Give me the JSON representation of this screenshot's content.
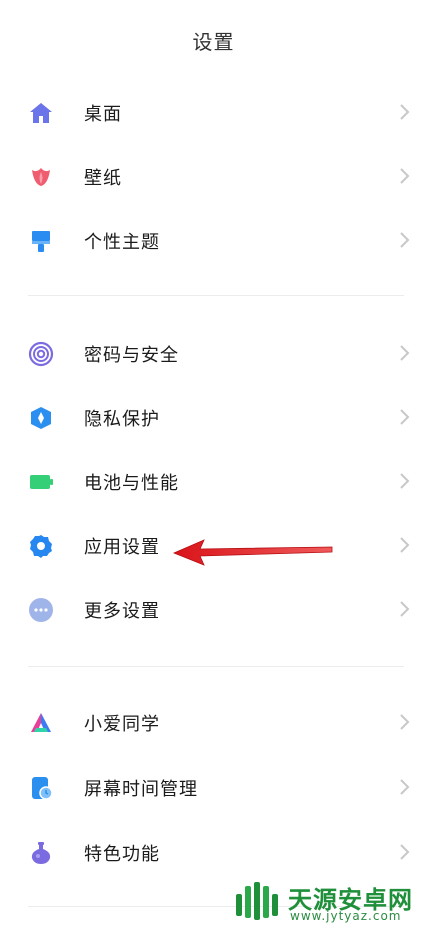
{
  "header": {
    "title": "设置"
  },
  "groups": [
    {
      "items": [
        {
          "label": "桌面",
          "icon": "home-icon",
          "color": "#6b74e8"
        },
        {
          "label": "壁纸",
          "icon": "tulip-icon",
          "color": "#ef5d6f"
        },
        {
          "label": "个性主题",
          "icon": "paintbrush-icon",
          "color": "#2a8cf0"
        }
      ]
    },
    {
      "items": [
        {
          "label": "密码与安全",
          "icon": "fingerprint-icon",
          "color": "#7b6be0"
        },
        {
          "label": "隐私保护",
          "icon": "privacy-shield-icon",
          "color": "#2b8ff0"
        },
        {
          "label": "电池与性能",
          "icon": "battery-icon",
          "color": "#34cf77"
        },
        {
          "label": "应用设置",
          "icon": "gear-icon",
          "color": "#2787f0"
        },
        {
          "label": "更多设置",
          "icon": "more-dots-icon",
          "color": "#9fb4e8"
        }
      ]
    },
    {
      "items": [
        {
          "label": "小爱同学",
          "icon": "xiaoai-icon",
          "color": "#3d7bf0"
        },
        {
          "label": "屏幕时间管理",
          "icon": "screen-time-icon",
          "color": "#2b8ff0"
        },
        {
          "label": "特色功能",
          "icon": "flask-icon",
          "color": "#7b6be0"
        }
      ]
    }
  ],
  "watermark": {
    "title": "天源安卓网",
    "url": "www.jytyaz.com"
  },
  "colors": {
    "chevron": "#c8c8c8",
    "arrow": "#e31b1b",
    "divider": "#ececec"
  }
}
